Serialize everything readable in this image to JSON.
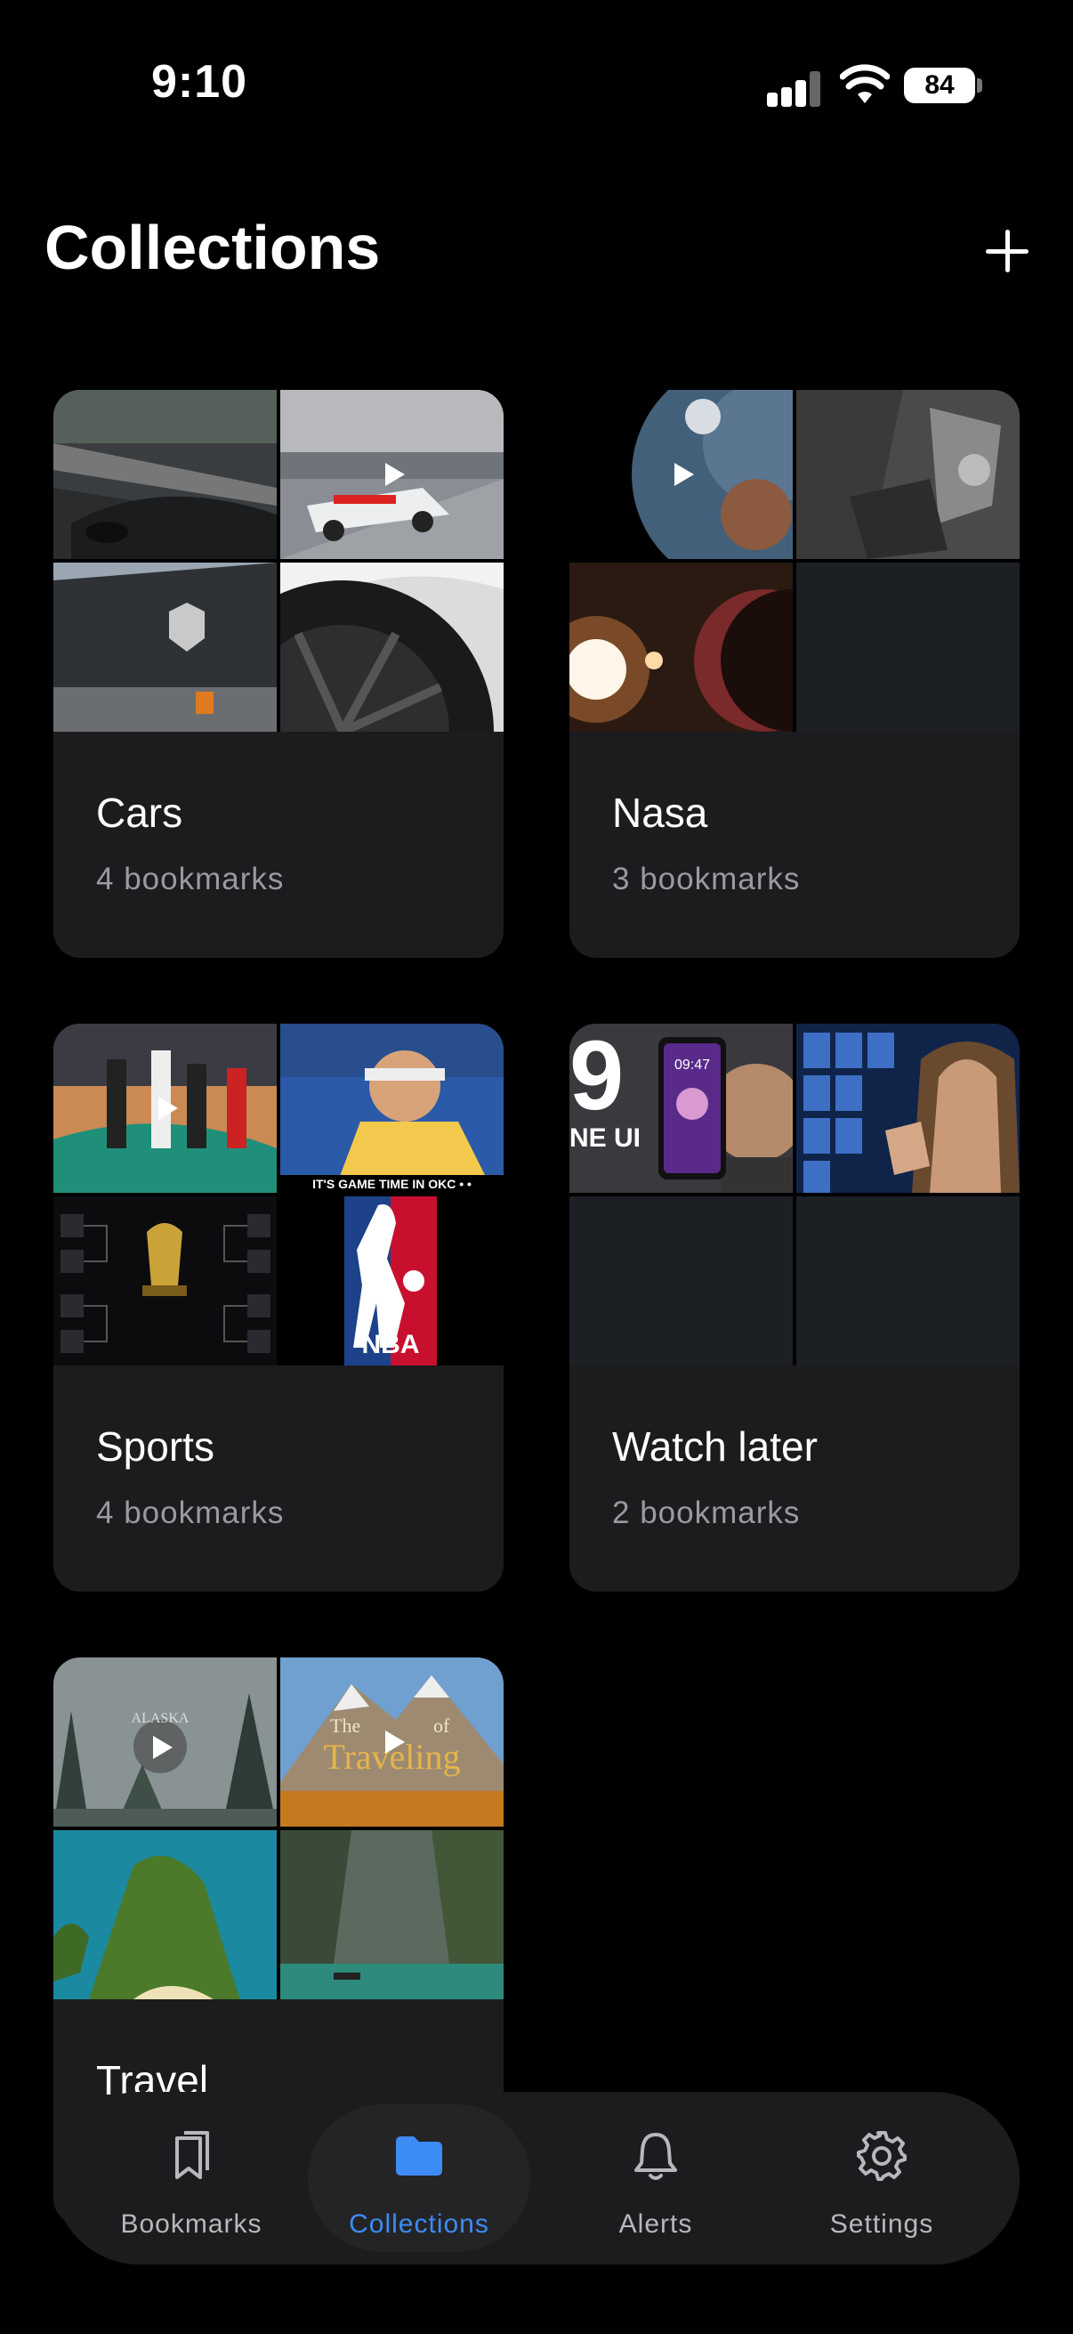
{
  "status": {
    "time": "9:10",
    "battery": "84"
  },
  "header": {
    "title": "Collections"
  },
  "collections": [
    {
      "name": "Cars",
      "count": "4 bookmarks"
    },
    {
      "name": "Nasa",
      "count": "3 bookmarks"
    },
    {
      "name": "Sports",
      "count": "4 bookmarks"
    },
    {
      "name": "Watch later",
      "count": "2 bookmarks"
    },
    {
      "name": "Travel",
      "count": ""
    }
  ],
  "thumb_text": {
    "sports_caption": "IT'S GAME TIME IN OKC • •",
    "nba": "NBA",
    "watch_nine": "9",
    "watch_sub": "NE UI",
    "phone_time": "09:47",
    "alaska": "ALASKA",
    "travel_the": "The",
    "travel_of": "of",
    "travel_main": "Traveling"
  },
  "tabs": [
    {
      "label": "Bookmarks",
      "icon": "bookmarks-icon",
      "active": false
    },
    {
      "label": "Collections",
      "icon": "folder-icon",
      "active": true
    },
    {
      "label": "Alerts",
      "icon": "bell-icon",
      "active": false
    },
    {
      "label": "Settings",
      "icon": "gear-icon",
      "active": false
    }
  ],
  "colors": {
    "accent": "#3d8cf5",
    "card": "#1c1c1e",
    "background": "#000000"
  }
}
